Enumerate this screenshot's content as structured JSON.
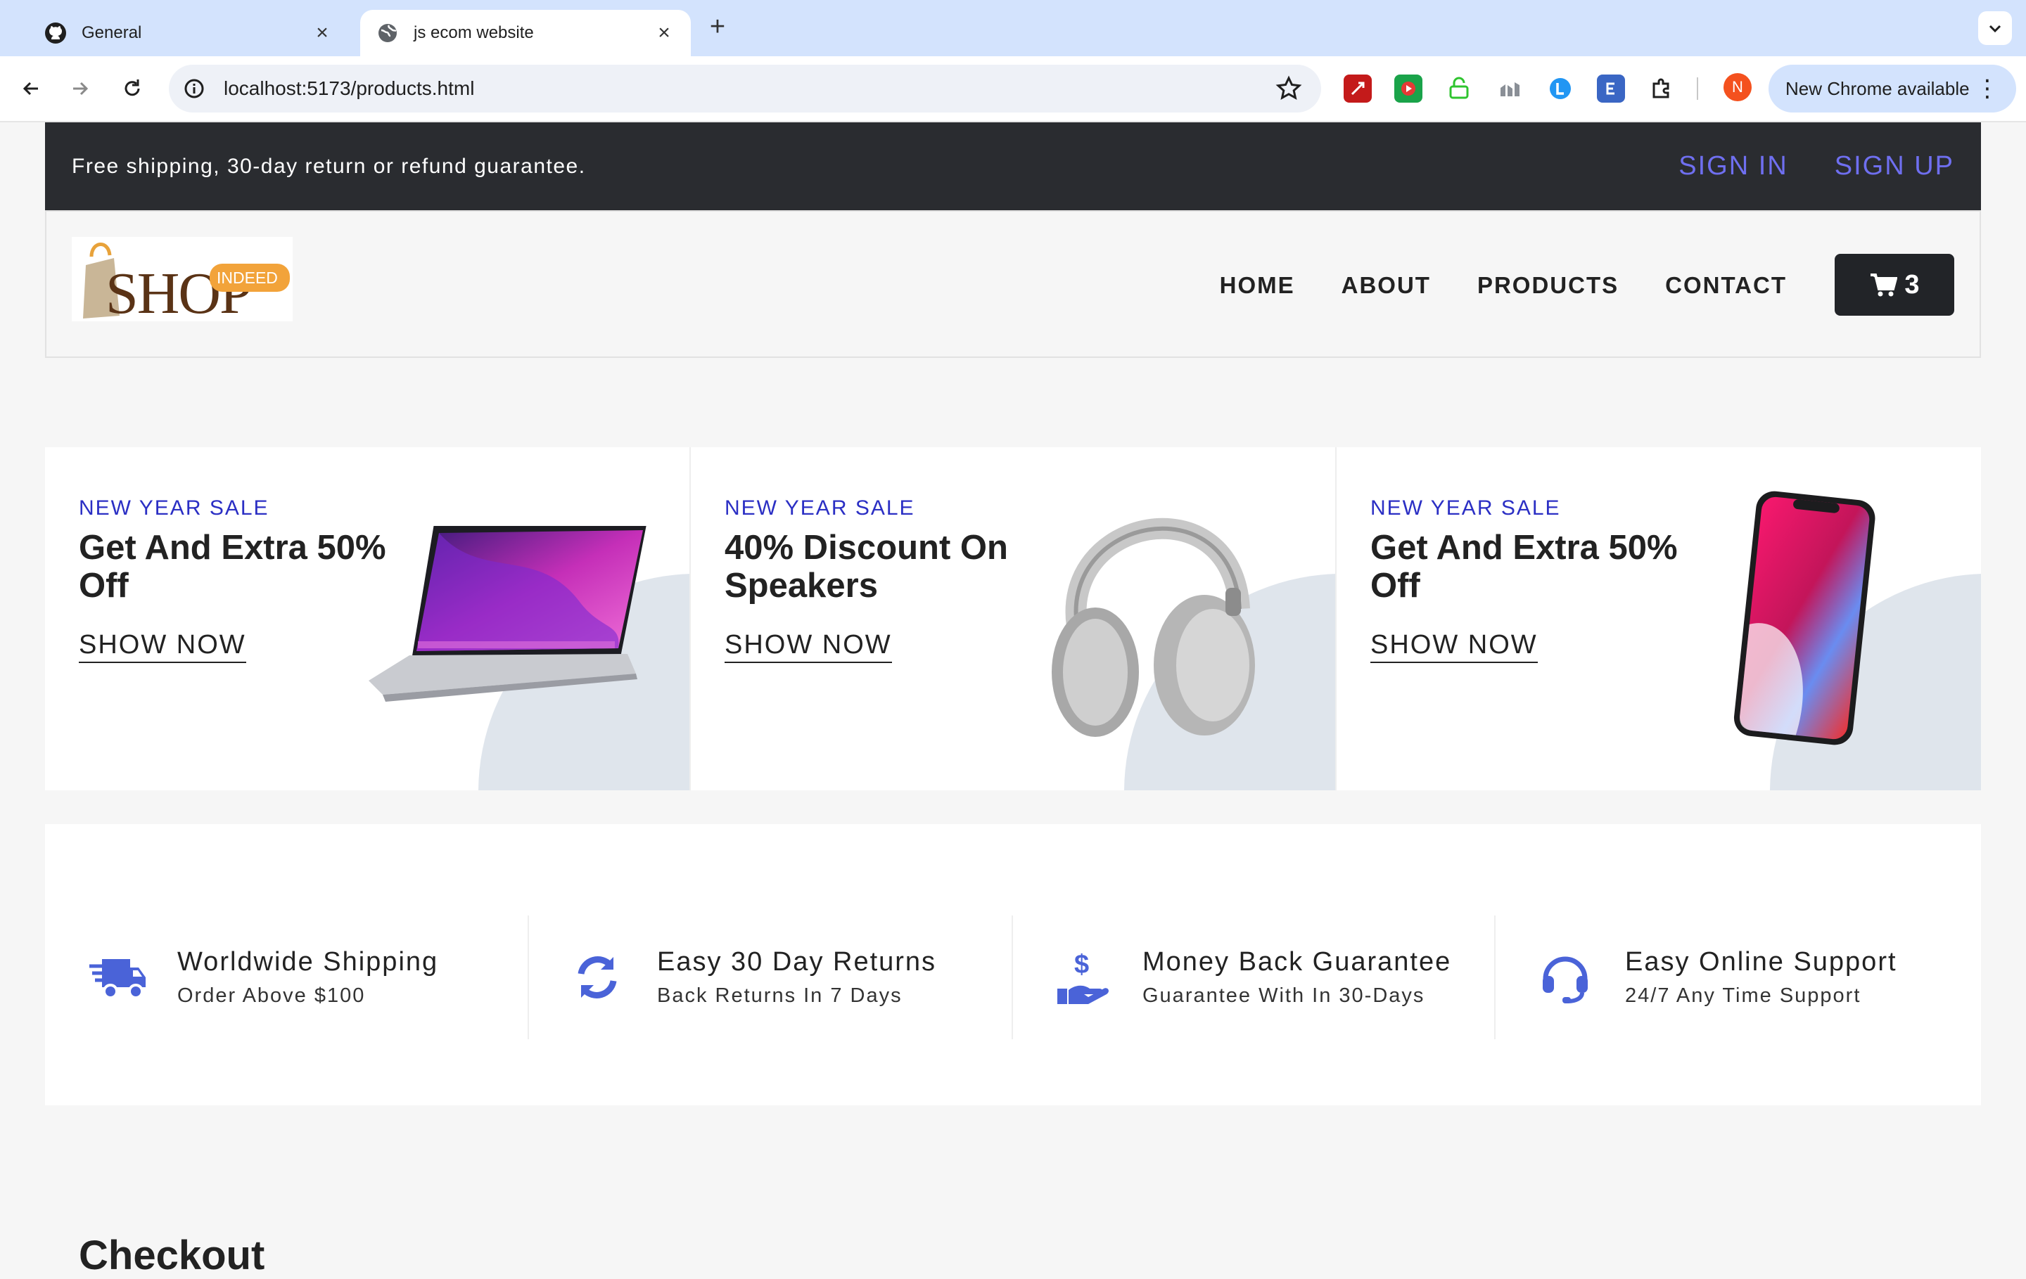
{
  "browser": {
    "tabs": [
      {
        "title": "General",
        "active": false
      },
      {
        "title": "js ecom website",
        "active": true
      }
    ],
    "url": "localhost:5173/products.html",
    "profile_initial": "N",
    "update_label": "New Chrome available"
  },
  "topbar": {
    "promo": "Free shipping, 30-day return or refund guarantee.",
    "sign_in": "SIGN IN",
    "sign_up": "SIGN UP"
  },
  "header": {
    "logo_word": "SHOP",
    "logo_tag": "INDEED",
    "nav": [
      "HOME",
      "ABOUT",
      "PRODUCTS",
      "CONTACT"
    ],
    "cart_count": "3"
  },
  "banners": [
    {
      "eyebrow": "NEW YEAR SALE",
      "title": "Get And Extra 50% Off",
      "cta": "SHOW NOW",
      "image": "laptop"
    },
    {
      "eyebrow": "NEW YEAR SALE",
      "title": "40% Discount On Speakers",
      "cta": "SHOW NOW",
      "image": "headphones"
    },
    {
      "eyebrow": "NEW YEAR SALE",
      "title": "Get And Extra 50% Off",
      "cta": "SHOW NOW",
      "image": "smartphone"
    }
  ],
  "features": [
    {
      "icon": "shipping-truck-icon",
      "title": "Worldwide Shipping",
      "subtitle": "Order Above $100"
    },
    {
      "icon": "refresh-icon",
      "title": "Easy 30 Day Returns",
      "subtitle": "Back Returns In 7 Days"
    },
    {
      "icon": "money-hand-icon",
      "title": "Money Back Guarantee",
      "subtitle": "Guarantee With In 30-Days"
    },
    {
      "icon": "headset-icon",
      "title": "Easy Online Support",
      "subtitle": "24/7 Any Time Support"
    }
  ],
  "section_heading": "Checkout",
  "colors": {
    "accent": "#6f6ff0",
    "eyebrow": "#2b2fc4",
    "icon_blue": "#4a63d8",
    "dark": "#2a2c30"
  }
}
